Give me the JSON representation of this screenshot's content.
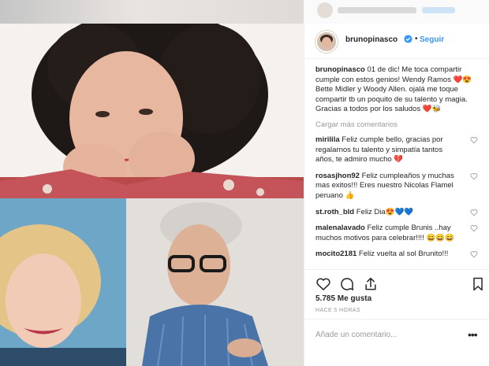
{
  "post": {
    "username": "brunopinasco",
    "follow_label": "Seguir",
    "separator": "•",
    "caption_user": "brunopinasco",
    "caption_text": "01 de dic! Me toca compartir cumple con estos genios! Wendy Ramos ❤️😍 Bette Midler y Woody Allen. ojalá me toque compartir tb un poquito de su talento y magia.",
    "caption_text2": "Gracias a todos por los saludos ❤️🐝",
    "load_more": "Cargar más comentarios",
    "likes": "5.785 Me gusta",
    "time_ago": "HACE 5 HORAS",
    "comment_placeholder": "Añade un comentario...",
    "more_options": "•••"
  },
  "comments": [
    {
      "user": "mirilila",
      "text": "Feliz cumple bello, gracias por regalarnos tu talento y simpatía tantos años, te admiro mucho 💔"
    },
    {
      "user": "rosasjhon92",
      "text": "Feliz cumpleaños y muchas mas exitos!!! Eres nuestro Nicolas Flamel peruano 👍"
    },
    {
      "user": "st.roth_bld",
      "text": "Feliz Dia😍💙💙"
    },
    {
      "user": "malenalavado",
      "text": "Feliz cumple Brunis ..hay muchos motivos para celebrar!!!! 😄😄😄"
    },
    {
      "user": "mocito2181",
      "text": "Feliz vuelta al sol Brunito!!!"
    }
  ],
  "icons": {
    "verified": "verified-badge-icon",
    "like": "heart-icon",
    "comment": "comment-icon",
    "share": "share-icon",
    "save": "bookmark-icon"
  },
  "colors": {
    "link_blue": "#3897f0",
    "text": "#262626",
    "muted": "#999999"
  }
}
